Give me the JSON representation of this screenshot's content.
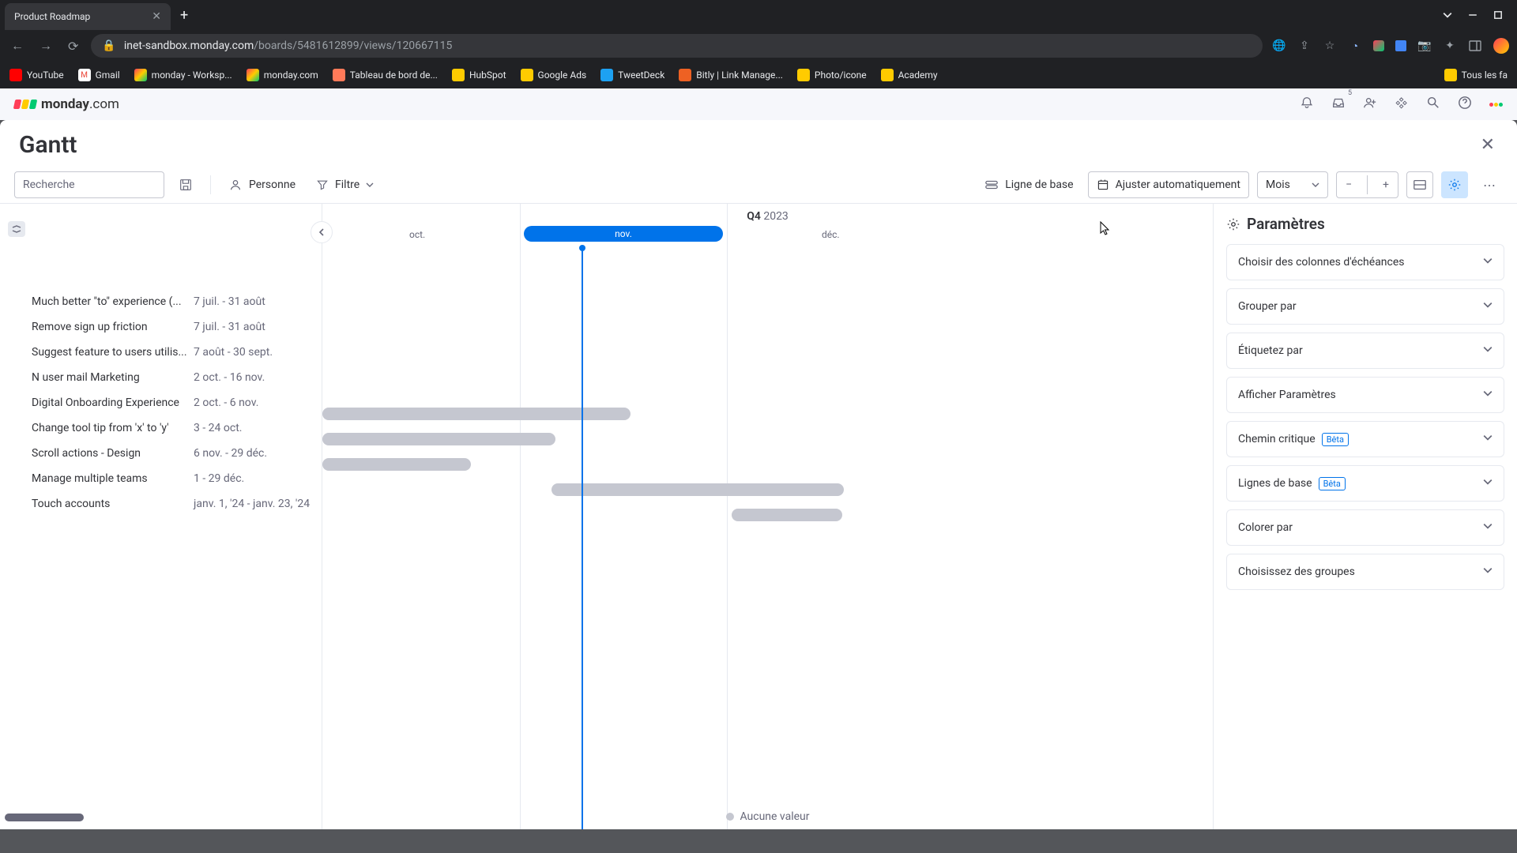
{
  "browser": {
    "tab_title": "Product Roadmap",
    "url_host": "inet-sandbox.monday.com",
    "url_path": "/boards/5481612899/views/120667115"
  },
  "bookmarks": [
    "YouTube",
    "Gmail",
    "monday - Worksp...",
    "monday.com",
    "Tableau de bord de...",
    "HubSpot",
    "Google Ads",
    "TweetDeck",
    "Bitly | Link Manage...",
    "Photo/icone",
    "Academy",
    "Tous les fa"
  ],
  "app": {
    "logo_text": "monday",
    "logo_suffix": ".com",
    "notif_count": "5"
  },
  "gantt": {
    "title": "Gantt",
    "search_ph": "Recherche",
    "toolbar": {
      "personne": "Personne",
      "filtre": "Filtre",
      "baseline": "Ligne de base",
      "autofit": "Ajuster automatiquement",
      "period": "Mois"
    },
    "quarter": "Q4",
    "year": "2023",
    "months": {
      "oct": "oct.",
      "nov": "nov.",
      "dec": "déc."
    },
    "tasks": [
      {
        "name": "Much better \"to\" experience (...",
        "dates": "7 juil. - 31 août"
      },
      {
        "name": "Remove sign up friction",
        "dates": "7 juil. - 31 août"
      },
      {
        "name": "Suggest feature to users utilis...",
        "dates": "7 août - 30 sept."
      },
      {
        "name": "N user mail Marketing",
        "dates": "2 oct. - 16 nov."
      },
      {
        "name": "Digital Onboarding Experience",
        "dates": "2 oct. - 6 nov."
      },
      {
        "name": "Change tool tip from 'x' to 'y'",
        "dates": "3 - 24 oct."
      },
      {
        "name": "Scroll actions - Design",
        "dates": "6 nov. - 29 déc."
      },
      {
        "name": "Manage multiple teams",
        "dates": "1 - 29 déc."
      },
      {
        "name": "Touch accounts",
        "dates": "janv. 1, '24 - janv. 23, '24"
      }
    ],
    "legend": "Aucune valeur"
  },
  "settings": {
    "title": "Paramètres",
    "items": [
      {
        "label": "Choisir des colonnes d'échéances"
      },
      {
        "label": "Grouper par"
      },
      {
        "label": "Étiquetez par"
      },
      {
        "label": "Afficher Paramètres"
      },
      {
        "label": "Chemin critique",
        "beta": "Bêta"
      },
      {
        "label": "Lignes de base",
        "beta": "Bêta"
      },
      {
        "label": "Colorer par"
      },
      {
        "label": "Choisissez des groupes"
      }
    ]
  }
}
